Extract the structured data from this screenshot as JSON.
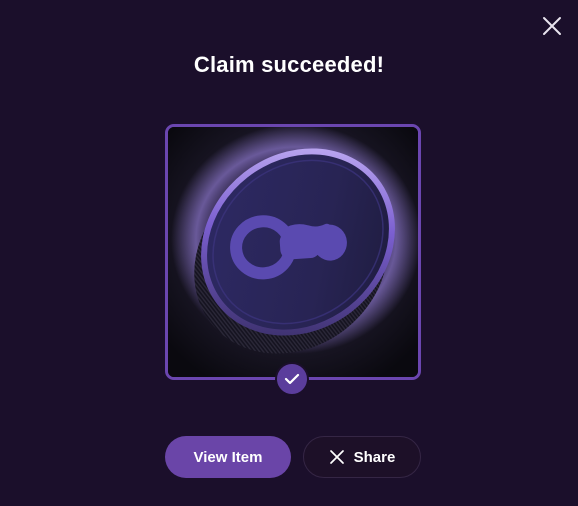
{
  "modal": {
    "title": "Claim succeeded!"
  },
  "actions": {
    "view_item_label": "View Item",
    "share_label": "Share"
  },
  "icons": {
    "close": "close-icon",
    "check": "checkmark-icon",
    "x_logo": "x-logo-icon",
    "coin_logo": "infinity-logo-icon"
  },
  "colors": {
    "background": "#1b0f2b",
    "accent": "#6a45a8",
    "frame_border": "#6b46b0",
    "text": "#ffffff"
  }
}
